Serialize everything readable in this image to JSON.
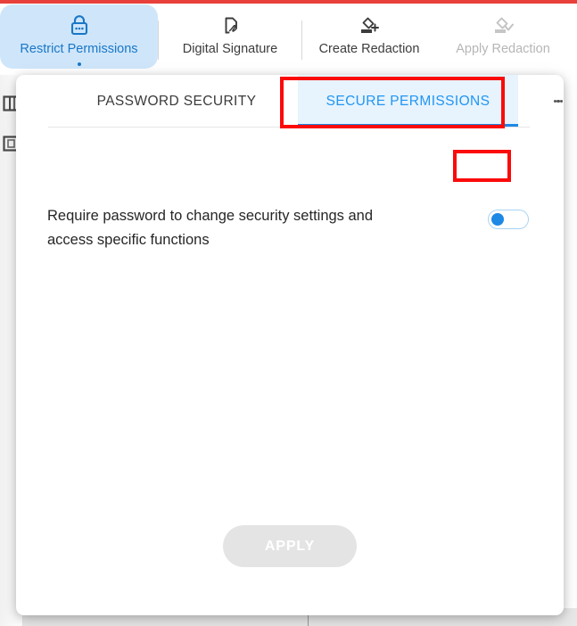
{
  "toolbar": {
    "items": [
      {
        "id": "restrict-permissions",
        "label": "Restrict Permissions",
        "icon": "lock-icon",
        "state": "active"
      },
      {
        "id": "digital-signature",
        "label": "Digital Signature",
        "icon": "document-signature-icon",
        "state": "normal"
      },
      {
        "id": "create-redaction",
        "label": "Create Redaction",
        "icon": "redaction-plus-icon",
        "state": "normal"
      },
      {
        "id": "apply-redaction",
        "label": "Apply Redaction",
        "icon": "redaction-check-icon",
        "state": "disabled"
      }
    ]
  },
  "left_rail": {
    "items": [
      {
        "id": "panel-toggle",
        "icon": "panel-layout-icon"
      },
      {
        "id": "page-thumbnails",
        "icon": "page-thumbnail-icon"
      }
    ]
  },
  "dialog": {
    "tabs": [
      {
        "id": "password-security",
        "label": "PASSWORD SECURITY",
        "active": false
      },
      {
        "id": "secure-permissions",
        "label": "SECURE PERMISSIONS",
        "active": true
      }
    ],
    "overflow_menu_icon": "kebab-menu-icon",
    "setting": {
      "label": "Require password to change security settings and access specific functions",
      "toggle_state": "off"
    },
    "apply_button": {
      "label": "APPLY",
      "enabled": false
    }
  },
  "colors": {
    "accent_blue": "#2196f3",
    "accent_blue_dark": "#1e88e5",
    "active_tool_bg": "#cfe6fa",
    "active_tab_bg": "#e7f3fd",
    "annotation_red": "#fb0a0a",
    "disabled_grey": "#e4e4e4",
    "toggle_track_border": "#a8d3f2"
  }
}
